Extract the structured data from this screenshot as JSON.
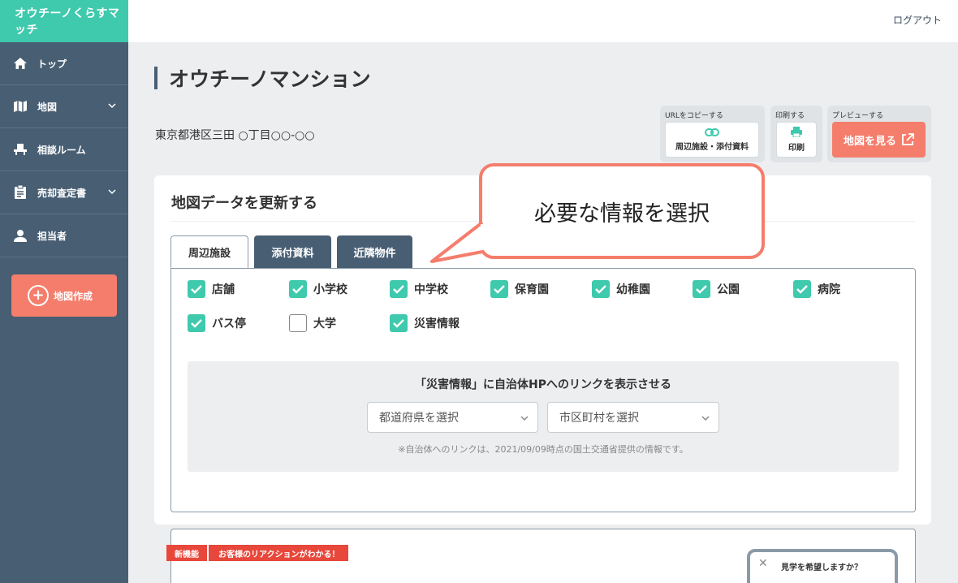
{
  "app": {
    "logo": "オウチーノくらすマッチ",
    "logout": "ログアウト"
  },
  "sidebar": {
    "items": [
      {
        "label": "トップ",
        "icon": "home-icon",
        "expandable": false
      },
      {
        "label": "地図",
        "icon": "map-icon",
        "expandable": true
      },
      {
        "label": "相談ルーム",
        "icon": "consultation-icon",
        "expandable": false
      },
      {
        "label": "売却査定書",
        "icon": "clipboard-icon",
        "expandable": true
      },
      {
        "label": "担当者",
        "icon": "person-icon",
        "expandable": false
      }
    ],
    "create_button": "地図作成"
  },
  "header": {
    "title": "オウチーノマンション",
    "address": "東京都港区三田 ○丁目○○-○○"
  },
  "actions": {
    "copy_caption": "URLをコピーする",
    "copy_button": "周辺施設・添付資料",
    "print_caption": "印刷する",
    "print_button": "印刷",
    "preview_caption": "プレビューする",
    "preview_button": "地図を見る"
  },
  "card": {
    "title": "地図データを更新する",
    "tabs": [
      {
        "label": "周辺施設",
        "active": true
      },
      {
        "label": "添付資料",
        "active": false
      },
      {
        "label": "近隣物件",
        "active": false
      }
    ],
    "checkboxes": [
      {
        "label": "店舗",
        "checked": true
      },
      {
        "label": "小学校",
        "checked": true
      },
      {
        "label": "中学校",
        "checked": true
      },
      {
        "label": "保育園",
        "checked": true
      },
      {
        "label": "幼稚園",
        "checked": true
      },
      {
        "label": "公園",
        "checked": true
      },
      {
        "label": "病院",
        "checked": true
      },
      {
        "label": "バス停",
        "checked": true
      },
      {
        "label": "大学",
        "checked": false
      },
      {
        "label": "災害情報",
        "checked": true
      }
    ],
    "disaster": {
      "title": "「災害情報」に自治体HPへのリンクを表示させる",
      "prefecture_select": "都道府県を選択",
      "city_select": "市区町村を選択",
      "note": "※自治体へのリンクは、2021/09/09時点の国土交通省提供の情報です。"
    }
  },
  "callout": {
    "text": "必要な情報を選択"
  },
  "feature": {
    "badge_new": "新機能",
    "badge_text": "お客様のリアクションがわかる！",
    "popup_question": "見学を希望しますか？"
  },
  "colors": {
    "accent_green": "#3fc9ad",
    "sidebar": "#485e73",
    "coral": "#f47d6c"
  }
}
